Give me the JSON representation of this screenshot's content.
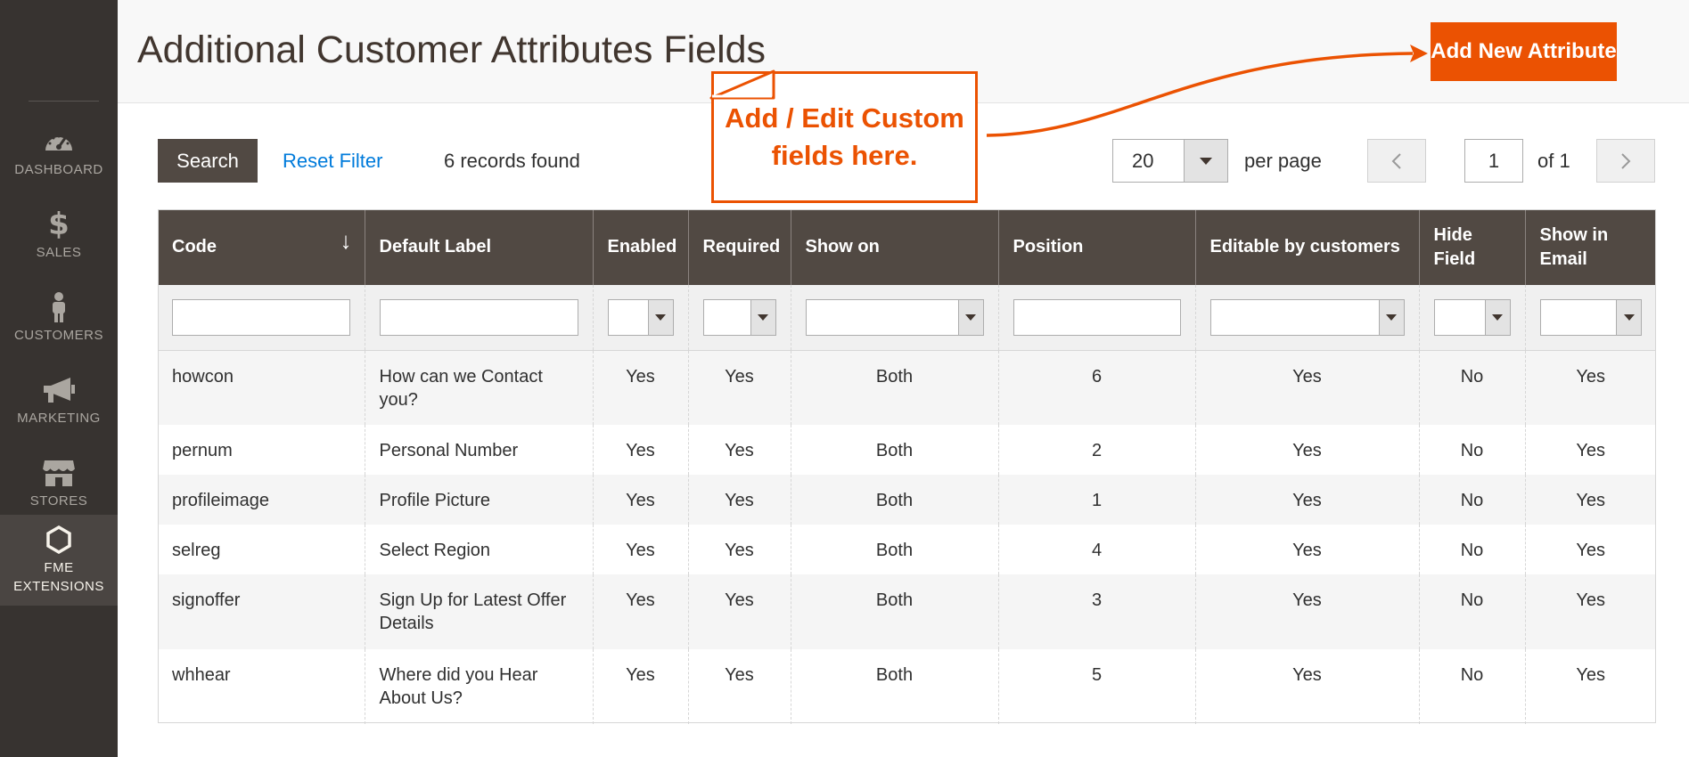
{
  "sidebar": {
    "items": [
      {
        "label": "DASHBOARD",
        "icon": "dashboard-icon"
      },
      {
        "label": "SALES",
        "icon": "dollar-icon"
      },
      {
        "label": "CUSTOMERS",
        "icon": "customer-icon"
      },
      {
        "label": "MARKETING",
        "icon": "megaphone-icon"
      },
      {
        "label": "STORES",
        "icon": "store-icon"
      },
      {
        "label_line1": "FME",
        "label_line2": "EXTENSIONS",
        "icon": "hexagon-icon",
        "active": true
      }
    ]
  },
  "header": {
    "title": "Additional Customer Attributes Fields",
    "add_button": "Add New Attribute"
  },
  "callout": {
    "line1": "Add / Edit Custom",
    "line2": "fields here."
  },
  "toolbar": {
    "search_label": "Search",
    "reset_label": "Reset Filter",
    "records_found": "6 records found",
    "per_page_value": "20",
    "per_page_label": "per page",
    "page_value": "1",
    "page_of": "of 1"
  },
  "grid": {
    "columns": [
      {
        "label": "Code"
      },
      {
        "label": "Default Label"
      },
      {
        "label": "Enabled"
      },
      {
        "label": "Required"
      },
      {
        "label": "Show on"
      },
      {
        "label": "Position"
      },
      {
        "label": "Editable by customers"
      },
      {
        "label_line1": "Hide",
        "label_line2": "Field"
      },
      {
        "label_line1": "Show in",
        "label_line2": "Email"
      }
    ],
    "sort_indicator": "↓",
    "rows": [
      {
        "code": "howcon",
        "label": "How can we Contact you?",
        "enabled": "Yes",
        "required": "Yes",
        "show_on": "Both",
        "position": "6",
        "editable": "Yes",
        "hide": "No",
        "email": "Yes"
      },
      {
        "code": "pernum",
        "label": "Personal Number",
        "enabled": "Yes",
        "required": "Yes",
        "show_on": "Both",
        "position": "2",
        "editable": "Yes",
        "hide": "No",
        "email": "Yes"
      },
      {
        "code": "profileimage",
        "label": "Profile Picture",
        "enabled": "Yes",
        "required": "Yes",
        "show_on": "Both",
        "position": "1",
        "editable": "Yes",
        "hide": "No",
        "email": "Yes"
      },
      {
        "code": "selreg",
        "label": "Select Region",
        "enabled": "Yes",
        "required": "Yes",
        "show_on": "Both",
        "position": "4",
        "editable": "Yes",
        "hide": "No",
        "email": "Yes"
      },
      {
        "code": "signoffer",
        "label": "Sign Up for Latest Offer Details",
        "enabled": "Yes",
        "required": "Yes",
        "show_on": "Both",
        "position": "3",
        "editable": "Yes",
        "hide": "No",
        "email": "Yes"
      },
      {
        "code": "whhear",
        "label": "Where did you Hear About Us?",
        "enabled": "Yes",
        "required": "Yes",
        "show_on": "Both",
        "position": "5",
        "editable": "Yes",
        "hide": "No",
        "email": "Yes"
      }
    ]
  },
  "colors": {
    "sidebar_bg": "#373330",
    "accent_orange": "#eb5202",
    "header_dark": "#514943",
    "link_blue": "#007bdb"
  }
}
